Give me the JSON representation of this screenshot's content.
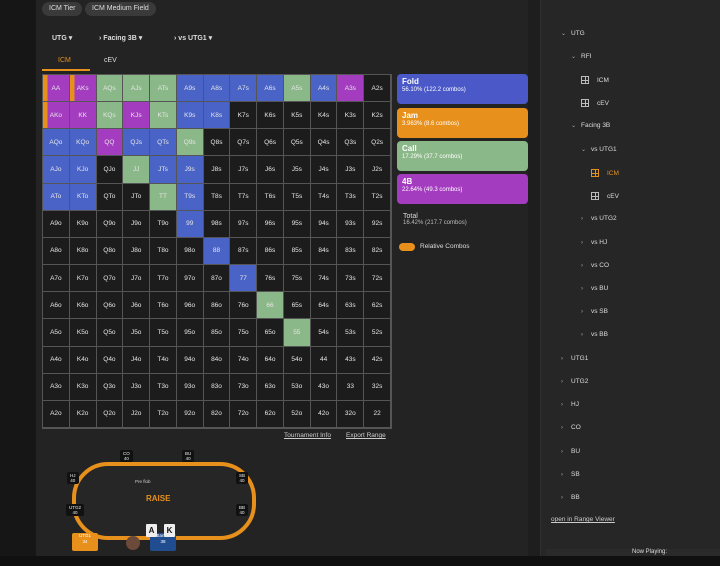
{
  "filters": {
    "chip1": "ICM Tier",
    "chip2": "ICM Medium Field"
  },
  "selectors": {
    "position": "UTG",
    "scenario": "Facing 3B",
    "opponent": "vs UTG1"
  },
  "tabs": [
    {
      "label": "ICM"
    },
    {
      "label": "cEV"
    }
  ],
  "grid": {
    "rows": [
      [
        "AA",
        "AKs",
        "AQs",
        "AJs",
        "ATs",
        "A9s",
        "A8s",
        "A7s",
        "A6s",
        "A5s",
        "A4s",
        "A3s",
        "A2s"
      ],
      [
        "AKo",
        "KK",
        "KQs",
        "KJs",
        "KTs",
        "K9s",
        "K8s",
        "K7s",
        "K6s",
        "K5s",
        "K4s",
        "K3s",
        "K2s"
      ],
      [
        "AQo",
        "KQo",
        "QQ",
        "QJs",
        "QTs",
        "Q9s",
        "Q8s",
        "Q7s",
        "Q6s",
        "Q5s",
        "Q4s",
        "Q3s",
        "Q2s"
      ],
      [
        "AJo",
        "KJo",
        "QJo",
        "JJ",
        "JTs",
        "J9s",
        "J8s",
        "J7s",
        "J6s",
        "J5s",
        "J4s",
        "J3s",
        "J2s"
      ],
      [
        "ATo",
        "KTo",
        "QTo",
        "JTo",
        "TT",
        "T9s",
        "T8s",
        "T7s",
        "T6s",
        "T5s",
        "T4s",
        "T3s",
        "T2s"
      ],
      [
        "A9o",
        "K9o",
        "Q9o",
        "J9o",
        "T9o",
        "99",
        "98s",
        "97s",
        "96s",
        "95s",
        "94s",
        "93s",
        "92s"
      ],
      [
        "A8o",
        "K8o",
        "Q8o",
        "J8o",
        "T8o",
        "98o",
        "88",
        "87s",
        "86s",
        "85s",
        "84s",
        "83s",
        "82s"
      ],
      [
        "A7o",
        "K7o",
        "Q7o",
        "J7o",
        "T7o",
        "97o",
        "87o",
        "77",
        "76s",
        "75s",
        "74s",
        "73s",
        "72s"
      ],
      [
        "A6o",
        "K6o",
        "Q6o",
        "J6o",
        "T6o",
        "96o",
        "86o",
        "76o",
        "66",
        "65s",
        "64s",
        "63s",
        "62s"
      ],
      [
        "A5o",
        "K5o",
        "Q5o",
        "J5o",
        "T5o",
        "95o",
        "85o",
        "75o",
        "65o",
        "55",
        "54s",
        "53s",
        "52s"
      ],
      [
        "A4o",
        "K4o",
        "Q4o",
        "J4o",
        "T4o",
        "94o",
        "84o",
        "74o",
        "64o",
        "54o",
        "44",
        "43s",
        "42s"
      ],
      [
        "A3o",
        "K3o",
        "Q3o",
        "J3o",
        "T3o",
        "93o",
        "83o",
        "73o",
        "63o",
        "53o",
        "43o",
        "33",
        "32s"
      ],
      [
        "A2o",
        "K2o",
        "Q2o",
        "J2o",
        "T2o",
        "92o",
        "82o",
        "72o",
        "62o",
        "52o",
        "42o",
        "32o",
        "22"
      ]
    ]
  },
  "legend": [
    {
      "label": "Fold",
      "detail": "56.10% (122.2 combos)",
      "color": "#4a58c8"
    },
    {
      "label": "Jam",
      "detail": "3.963% (8.6 combos)",
      "color": "#e8901c"
    },
    {
      "label": "Call",
      "detail": "17.29% (37.7 combos)",
      "color": "#8bb888"
    },
    {
      "label": "4B",
      "detail": "22.64% (49.3 combos)",
      "color": "#a43cc0"
    }
  ],
  "total": {
    "label": "Total",
    "detail": "16.42% (217.7 combos)"
  },
  "toggle": {
    "label": "Relative Combos",
    "on": true
  },
  "links": {
    "tournament": "Tournament Info",
    "export": "Export Range",
    "range_viewer": "open in Range Viewer"
  },
  "table": {
    "seats": [
      {
        "name": "CO",
        "stack": "40"
      },
      {
        "name": "BU",
        "stack": "40"
      },
      {
        "name": "HJ",
        "stack": "40"
      },
      {
        "name": "SB",
        "stack": "40"
      },
      {
        "name": "UTG2",
        "stack": "40"
      },
      {
        "name": "BB",
        "stack": "40"
      },
      {
        "name": "UTG1",
        "stack": "34"
      },
      {
        "name": "Banob",
        "stack": "38"
      }
    ],
    "pot_label": "Pre flob",
    "logo": "RAISE",
    "hero_cards": [
      "A",
      "K"
    ]
  },
  "tree": [
    {
      "label": "UTG",
      "depth": 0,
      "expanded": true
    },
    {
      "label": "RFI",
      "depth": 1,
      "expanded": true
    },
    {
      "label": "ICM",
      "depth": 2,
      "type": "range"
    },
    {
      "label": "cEV",
      "depth": 2,
      "type": "range"
    },
    {
      "label": "Facing 3B",
      "depth": 1,
      "expanded": true
    },
    {
      "label": "vs UTG1",
      "depth": 2,
      "expanded": true
    },
    {
      "label": "ICM",
      "depth": 3,
      "type": "range",
      "active": true
    },
    {
      "label": "cEV",
      "depth": 3,
      "type": "range"
    },
    {
      "label": "vs UTG2",
      "depth": 2
    },
    {
      "label": "vs HJ",
      "depth": 2
    },
    {
      "label": "vs CO",
      "depth": 2
    },
    {
      "label": "vs BU",
      "depth": 2
    },
    {
      "label": "vs SB",
      "depth": 2
    },
    {
      "label": "vs BB",
      "depth": 2
    },
    {
      "label": "UTG1",
      "depth": 0
    },
    {
      "label": "UTG2",
      "depth": 0
    },
    {
      "label": "HJ",
      "depth": 0
    },
    {
      "label": "CO",
      "depth": 0
    },
    {
      "label": "BU",
      "depth": 0
    },
    {
      "label": "SB",
      "depth": 0
    },
    {
      "label": "BB",
      "depth": 0
    }
  ],
  "now_playing": "Now Playing:"
}
